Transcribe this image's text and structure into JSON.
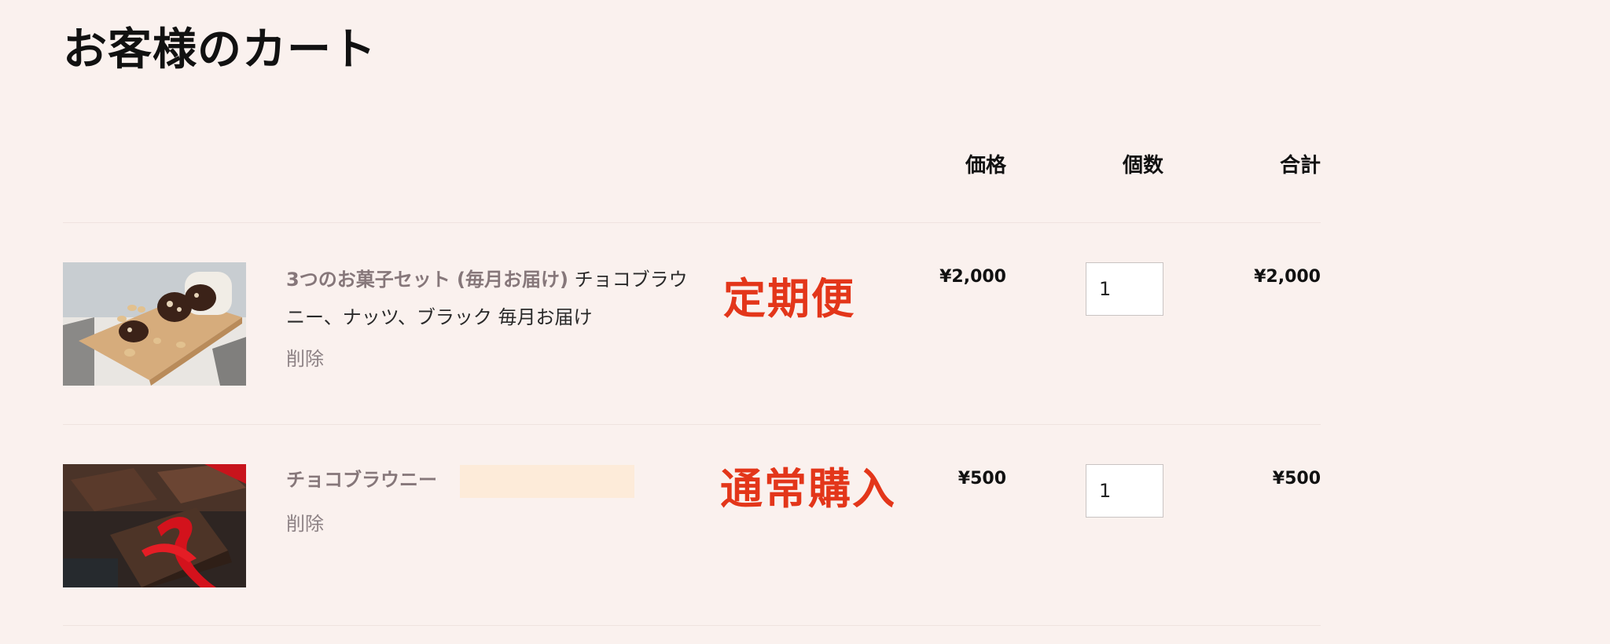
{
  "page": {
    "title": "お客様のカート"
  },
  "table": {
    "headers": {
      "price": "価格",
      "quantity": "個数",
      "total": "合計"
    }
  },
  "items": [
    {
      "name": "3つのお菓子セット (毎月お届け)",
      "options": " チョコブラウニー、ナッツ、ブラック 毎月お届け",
      "remove_label": "削除",
      "annotation": "定期便",
      "price": "¥2,000",
      "quantity": "1",
      "total": "¥2,000",
      "image_icon": "brownie-slices-on-board"
    },
    {
      "name": "チョコブラウニー",
      "options": "",
      "remove_label": "削除",
      "annotation": "通常購入",
      "price": "¥500",
      "quantity": "1",
      "total": "¥500",
      "image_icon": "brownie-with-red-ribbon"
    }
  ],
  "colors": {
    "background": "#faf1ee",
    "annotation": "#e3361a",
    "product_link": "#86777a",
    "highlight_box": "#fdebd9"
  }
}
